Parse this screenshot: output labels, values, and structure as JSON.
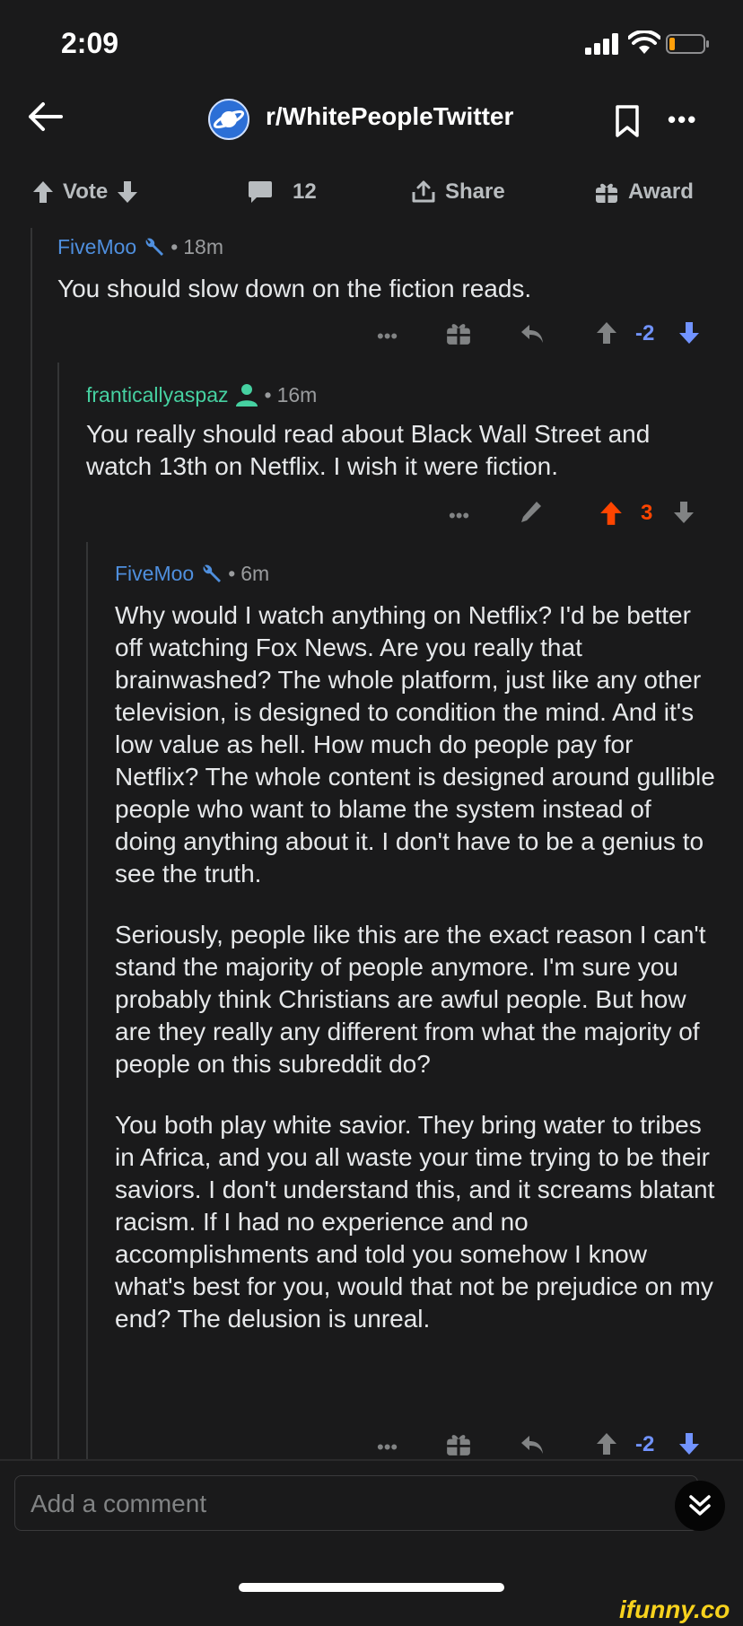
{
  "status": {
    "time": "2:09"
  },
  "header": {
    "subreddit": "r/WhitePeopleTwitter"
  },
  "actions": {
    "vote": "Vote",
    "comments": "12",
    "share": "Share",
    "award": "Award"
  },
  "comments": [
    {
      "author": "FiveMoo",
      "time": "18m",
      "body": [
        "You should slow down on the fiction reads."
      ],
      "score": "-2"
    },
    {
      "author": "franticallyaspaz",
      "time": "16m",
      "body": [
        "You really should read about Black Wall Street and watch 13th on Netflix. I wish it were fiction."
      ],
      "score": "3"
    },
    {
      "author": "FiveMoo",
      "time": "6m",
      "body": [
        "Why would I watch anything on Netflix? I'd be better off watching Fox News. Are you really that brainwashed? The whole platform, just like any other television, is designed to condition the mind. And it's low value as hell. How much do people pay for Netflix? The whole content is designed around gullible people who want to blame the system instead of doing anything about it. I don't have to be a genius to see the truth.",
        "Seriously, people like this are the exact reason I can't stand the majority of people anymore. I'm sure you probably think Christians are awful people. But how are they really any different from what the majority of people on this subreddit do?",
        "You both play white savior. They bring water to tribes in Africa, and you all waste your time trying to be their saviors. I don't understand this, and it screams blatant racism. If I had no experience and no accomplishments and told you somehow I know what's best for you, would that not be prejudice on my end? The delusion is unreal."
      ],
      "score": "-2"
    }
  ],
  "separator": "•",
  "more_dots": "•••",
  "composer": {
    "placeholder": "Add a comment"
  },
  "watermark": "ifunny.co",
  "colors": {
    "background": "#1a1a1b",
    "downvoted": "#7193ff",
    "upvoted": "#ff4500",
    "username": "#4f8fde",
    "op_username": "#46d1a1"
  }
}
